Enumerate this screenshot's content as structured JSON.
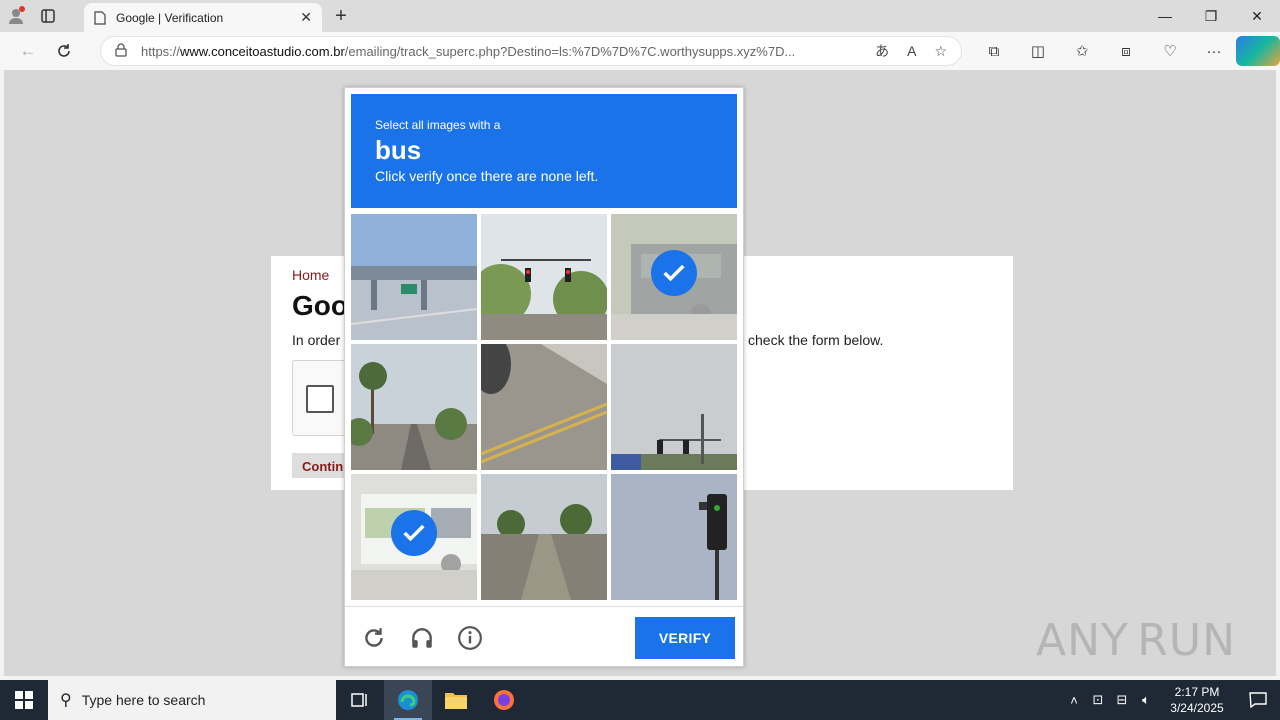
{
  "browser": {
    "tab_title": "Google | Verification",
    "url_prefix": "https://",
    "url_host": "www.conceitoastudio.com.br",
    "url_rest": "/emailing/track_superc.php?Destino=ls:%7D%7D%7C.worthysupps.xyz%7D..."
  },
  "page": {
    "home_link": "Home",
    "heading": "Goo",
    "intro_left": "In order",
    "intro_right": "check the form below.",
    "continue_label": "Contin"
  },
  "captcha": {
    "instruction_line1": "Select all images with a",
    "target_word": "bus",
    "instruction_line3": "Click verify once there are none left.",
    "verify_label": "VERIFY",
    "tiles": [
      {
        "selected": false
      },
      {
        "selected": false
      },
      {
        "selected": true
      },
      {
        "selected": false
      },
      {
        "selected": false
      },
      {
        "selected": false
      },
      {
        "selected": true
      },
      {
        "selected": false
      },
      {
        "selected": false
      }
    ]
  },
  "watermark": {
    "left": "ANY",
    "right": "RUN"
  },
  "taskbar": {
    "search_placeholder": "Type here to search",
    "time": "2:17 PM",
    "date": "3/24/2025"
  }
}
